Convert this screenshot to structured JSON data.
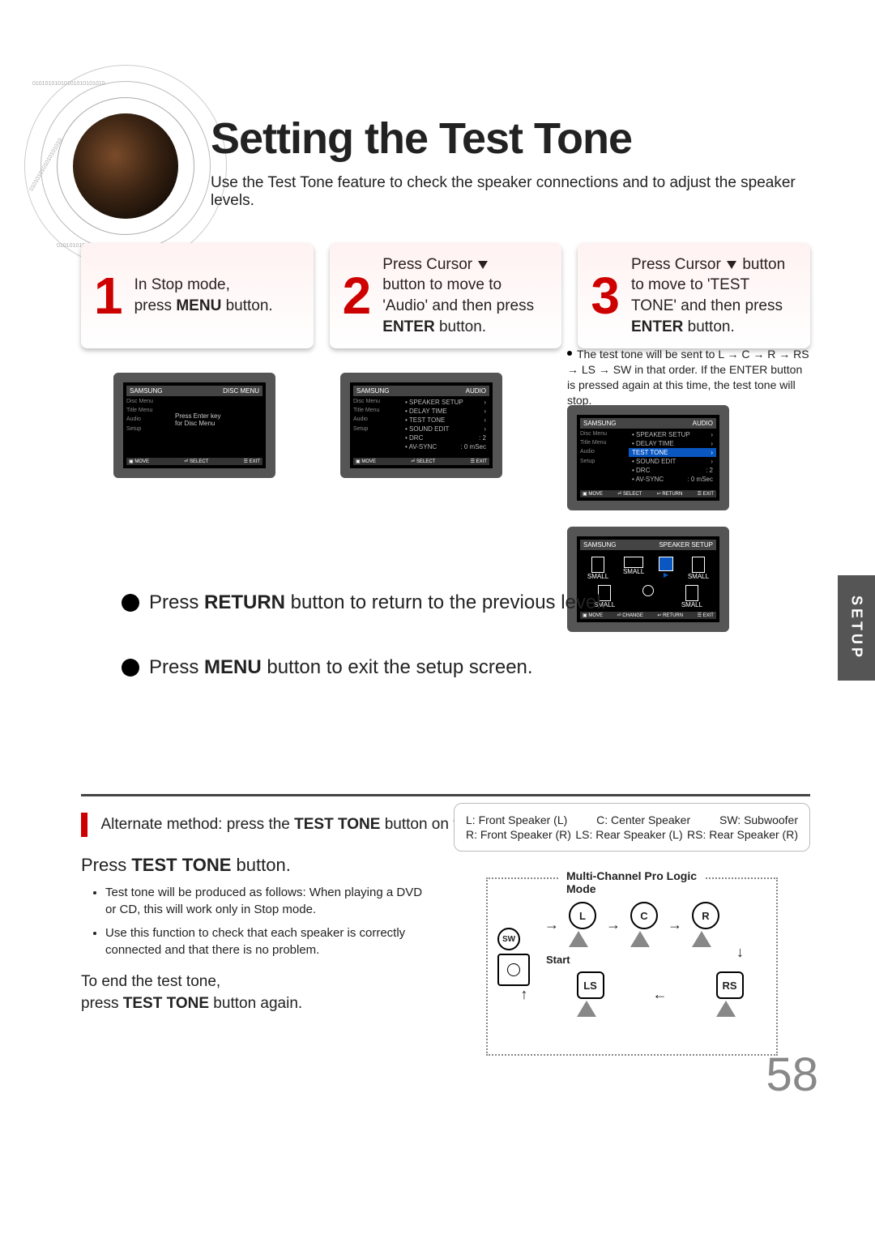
{
  "title": "Setting the Test Tone",
  "subtitle": "Use the Test Tone feature to check the speaker connections and to adjust the speaker levels.",
  "side_tab": "SETUP",
  "page_number": "58",
  "steps": {
    "s1": {
      "num": "1",
      "pre": "In Stop mode,",
      "mid": "press ",
      "bold": "MENU",
      "post": " button."
    },
    "s2": {
      "num": "2",
      "line1": "Press Cursor ",
      "line2": "button to move to 'Audio' and then press ",
      "bold": "ENTER",
      "post": " button."
    },
    "s3": {
      "num": "3",
      "line1": "Press Cursor ",
      "line2": " button to move to 'TEST TONE' and then press ",
      "bold": "ENTER",
      "post": " button."
    }
  },
  "note": "The test tone will be sent to L → C → R → RS → LS → SW in that order. If the ENTER button is pressed again at this time, the test tone will stop.",
  "line_return_pre": "Press ",
  "line_return_bold": "RETURN",
  "line_return_post": " button to return to the previous level.",
  "line_menu_pre": "Press ",
  "line_menu_bold": "MENU",
  "line_menu_post": " button to exit the setup screen.",
  "alt_method_pre": "Alternate method: press the ",
  "alt_method_bold": "TEST TONE",
  "alt_method_post": " button on the remote.",
  "press_tt_pre": "Press ",
  "press_tt_bold": "TEST TONE",
  "press_tt_post": " button.",
  "bullets": [
    "Test tone will be produced as follows: When playing a DVD or CD, this will work only in Stop mode.",
    "Use this function to check that each speaker is correctly connected and that there is no problem."
  ],
  "end_pre": "To end the test tone,",
  "end_mid": "press ",
  "end_bold": "TEST TONE",
  "end_post": " button again.",
  "legend": {
    "L": "L: Front Speaker (L)",
    "C": "C: Center Speaker",
    "SW": "SW: Subwoofer",
    "R": "R: Front Speaker (R)",
    "LS": "LS: Rear Speaker (L)",
    "RS": "RS: Rear Speaker (R)"
  },
  "diagram_label": "Multi-Channel Pro Logic Mode",
  "diagram_start": "Start",
  "spk": {
    "L": "L",
    "C": "C",
    "R": "R",
    "SW": "SW",
    "LS": "LS",
    "RS": "RS"
  },
  "osd": {
    "hdr_left": "SAMSUNG",
    "disc_menu": "DISC MENU",
    "audio": "AUDIO",
    "speaker_setup": "SPEAKER SETUP",
    "side": [
      "Disc Menu",
      "Title Menu",
      "Audio",
      "Setup"
    ],
    "menu1_main": "Press Enter key",
    "menu1_sub": "for Disc Menu",
    "audio_items": [
      "SPEAKER SETUP",
      "DELAY TIME",
      "TEST TONE",
      "SOUND EDIT",
      "DRC",
      "AV-SYNC"
    ],
    "drc_val": ": 2",
    "avsync_val": ": 0 mSec",
    "ftr": [
      "MOVE",
      "SELECT",
      "RETURN",
      "EXIT"
    ],
    "sp_labels": [
      "SMALL",
      "SMALL",
      "SMALL",
      "SMALL",
      "SMALL",
      "SMALL"
    ]
  }
}
